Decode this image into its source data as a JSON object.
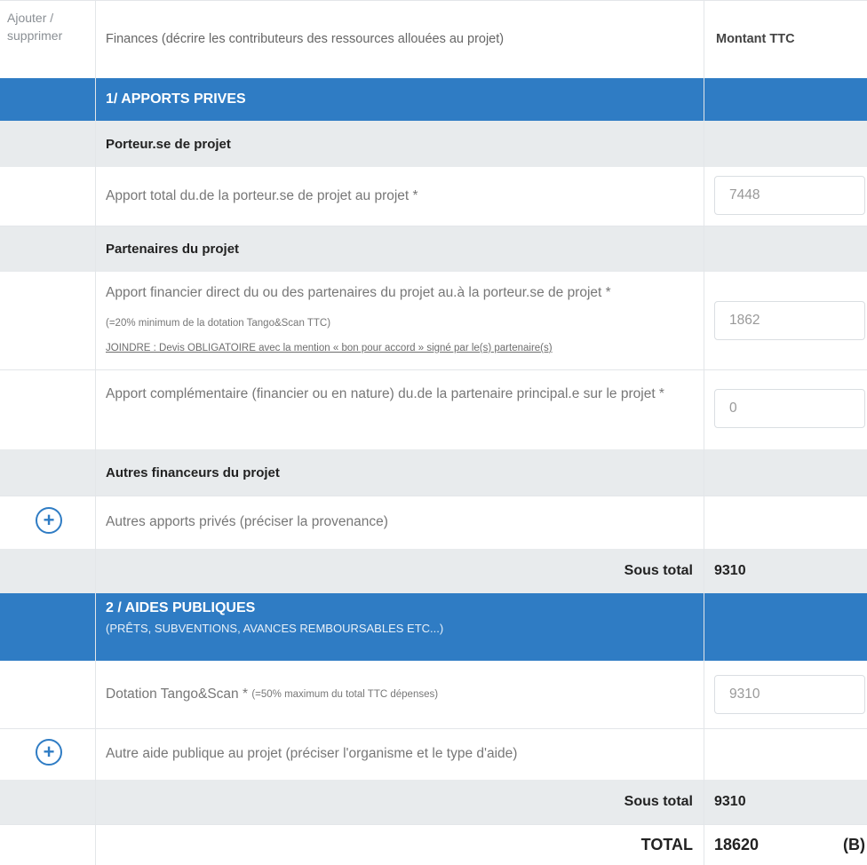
{
  "header": {
    "add_remove": "Ajouter / supprimer",
    "finances": "Finances (décrire les contributeurs des ressources allouées au projet)",
    "amount": "Montant TTC"
  },
  "section1": {
    "title": "1/ APPORTS PRIVES",
    "porteur": {
      "title": "Porteur.se de projet",
      "apport_label": "Apport total du.de la porteur.se de projet au projet *",
      "apport_value": "7448"
    },
    "partenaires": {
      "title": "Partenaires du projet",
      "direct_label": "Apport financier direct du ou des partenaires du projet au.à la porteur.se de projet *",
      "direct_note": "(=20% minimum de la dotation Tango&Scan TTC)",
      "direct_link": "JOINDRE : Devis OBLIGATOIRE avec la mention « bon pour accord » signé par le(s) partenaire(s)",
      "direct_value": "1862",
      "compl_label": "Apport complémentaire (financier ou en nature) du.de la partenaire principal.e sur le projet *",
      "compl_value": "0"
    },
    "autres": {
      "title": "Autres financeurs du projet",
      "label": "Autres apports privés (préciser la provenance)",
      "add_icon": "plus-circle-icon"
    },
    "subtotal_label": "Sous total",
    "subtotal_value": "9310"
  },
  "section2": {
    "title": "2 / AIDES PUBLIQUES",
    "subtitle": "(PRÊTS, SUBVENTIONS, AVANCES REMBOURSABLES ETC...)",
    "dotation_label": "Dotation Tango&Scan *",
    "dotation_note": "(=50% maximum du total TTC dépenses)",
    "dotation_value": "9310",
    "autre_label": "Autre aide publique au projet (préciser l'organisme et le type d'aide)",
    "add_icon": "plus-circle-icon",
    "subtotal_label": "Sous total",
    "subtotal_value": "9310"
  },
  "total": {
    "label": "TOTAL",
    "value": "18620",
    "marker": "(B)"
  },
  "colors": {
    "accent": "#2f7cc4",
    "band": "#e8ebed"
  }
}
